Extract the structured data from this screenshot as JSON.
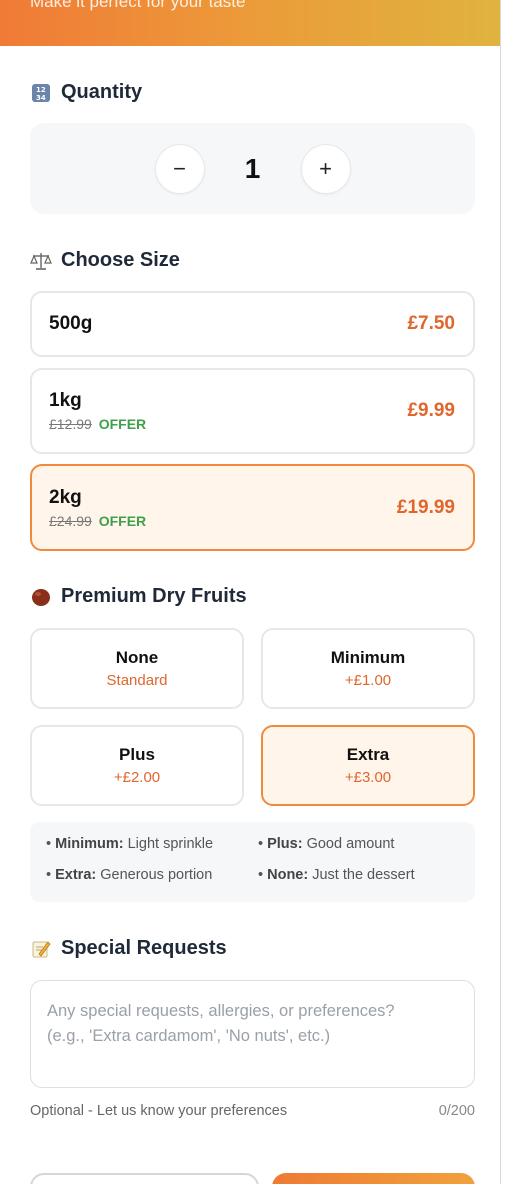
{
  "header": {
    "subtitle": "Make it perfect for your taste"
  },
  "quantity": {
    "title": "Quantity",
    "icon": "numbers-icon",
    "minus": "−",
    "plus": "+",
    "value": "1"
  },
  "size": {
    "title": "Choose Size",
    "icon": "scales-icon",
    "options": [
      {
        "name": "500g",
        "price": "£7.50",
        "old_price": "",
        "badge": "",
        "selected": false
      },
      {
        "name": "1kg",
        "price": "£9.99",
        "old_price": "£12.99",
        "badge": "OFFER",
        "selected": false
      },
      {
        "name": "2kg",
        "price": "£19.99",
        "old_price": "£24.99",
        "badge": "OFFER",
        "selected": true
      }
    ]
  },
  "fruits": {
    "title": "Premium Dry Fruits",
    "icon": "chestnut-icon",
    "options": [
      {
        "name": "None",
        "extra": "Standard",
        "selected": false
      },
      {
        "name": "Minimum",
        "extra": "+£1.00",
        "selected": false
      },
      {
        "name": "Plus",
        "extra": "+£2.00",
        "selected": false
      },
      {
        "name": "Extra",
        "extra": "+£3.00",
        "selected": true
      }
    ],
    "legend": [
      {
        "label": "Minimum:",
        "text": "Light sprinkle"
      },
      {
        "label": "Plus:",
        "text": "Good amount"
      },
      {
        "label": "Extra:",
        "text": "Generous portion"
      },
      {
        "label": "None:",
        "text": "Just the dessert"
      }
    ]
  },
  "requests": {
    "title": "Special Requests",
    "icon": "memo-icon",
    "placeholder": "Any special requests, allergies, or preferences?\n(e.g., 'Extra cardamom', 'No nuts', etc.)",
    "helper": "Optional - Let us know your preferences",
    "counter": "0/200"
  },
  "colors": {
    "accent": "#e0662d",
    "selected_border": "#f08a3c",
    "selected_bg": "#fff5ea",
    "offer": "#3fa04a"
  }
}
